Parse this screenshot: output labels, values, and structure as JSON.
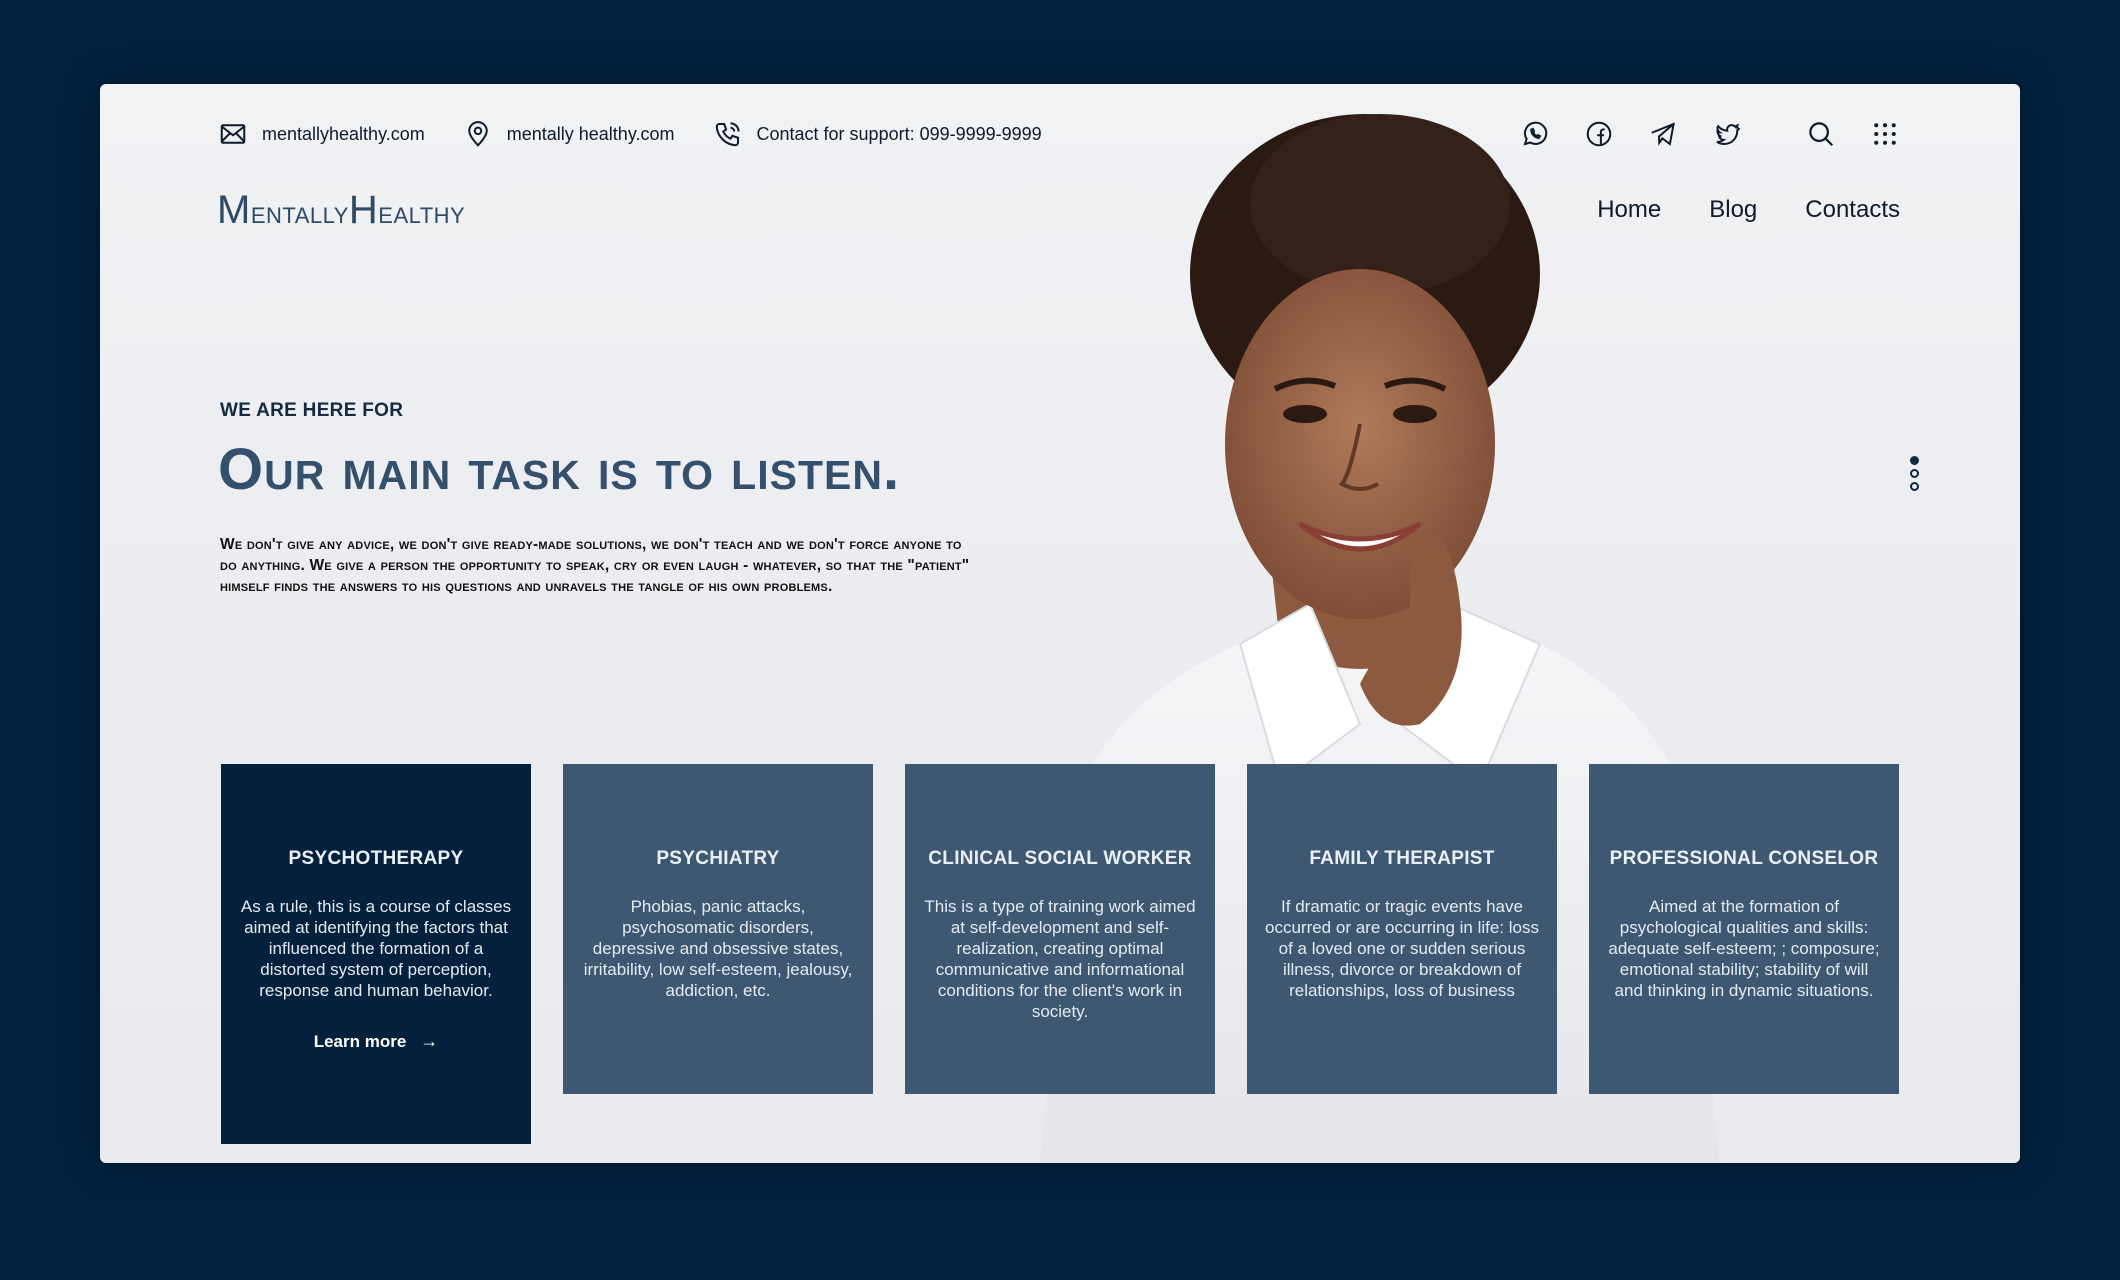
{
  "topbar": {
    "email": "mentallyhealthy.com",
    "location": "mentally healthy.com",
    "phone": "Contact for support: 099-9999-9999"
  },
  "social_icons": [
    "whatsapp-icon",
    "facebook-icon",
    "telegram-icon",
    "twitter-icon"
  ],
  "utility_icons": [
    "search-icon",
    "grid-menu-icon"
  ],
  "logo": {
    "part1_initial": "M",
    "part1_rest": "entally",
    "part2_initial": "H",
    "part2_rest": "ealthy"
  },
  "nav": {
    "home": "Home",
    "blog": "Blog",
    "contacts": "Contacts"
  },
  "hero": {
    "eyebrow": "WE ARE HERE FOR",
    "headline": "Our main task is to listen.",
    "body": "We don't give any advice, we don't give ready-made solutions, we don't teach and we don't force anyone to do anything. We give a person the opportunity to speak, cry or even laugh - whatever, so that the \"patient\" himself finds the answers to his questions and unravels the tangle of his own problems."
  },
  "slider": {
    "total": 3,
    "active_index": 0
  },
  "cards": [
    {
      "title": "PSYCHOTHERAPY",
      "text": "As a rule, this is a course of classes aimed at identifying the factors that influenced the formation of a distorted system of perception, response and human behavior.",
      "link": "Learn more"
    },
    {
      "title": "PSYCHIATRY",
      "text": "Phobias, panic attacks, psychosomatic disorders, depressive and obsessive states, irritability, low self-esteem, jealousy, addiction, etc."
    },
    {
      "title": "CLINICAL SOCIAL WORKER",
      "text": "This is a type of training work aimed at self-development and self-realization, creating optimal communicative and informational conditions for the client's work in society."
    },
    {
      "title": "FAMILY THERAPIST",
      "text": "If dramatic or tragic events have occurred or are occurring in life: loss of a loved one or sudden serious illness, divorce or breakdown of relationships, loss of business"
    },
    {
      "title": "PROFESSIONAL CONSELOR",
      "text": "Aimed at the formation of psychological qualities and skills: adequate self-esteem; ; composure; emotional stability; stability of will and thinking in dynamic situations."
    }
  ],
  "colors": {
    "page_bg": "#022241",
    "card_bg": "#2f4b67",
    "card_active_bg": "#04203d",
    "headline": "#34506c"
  }
}
